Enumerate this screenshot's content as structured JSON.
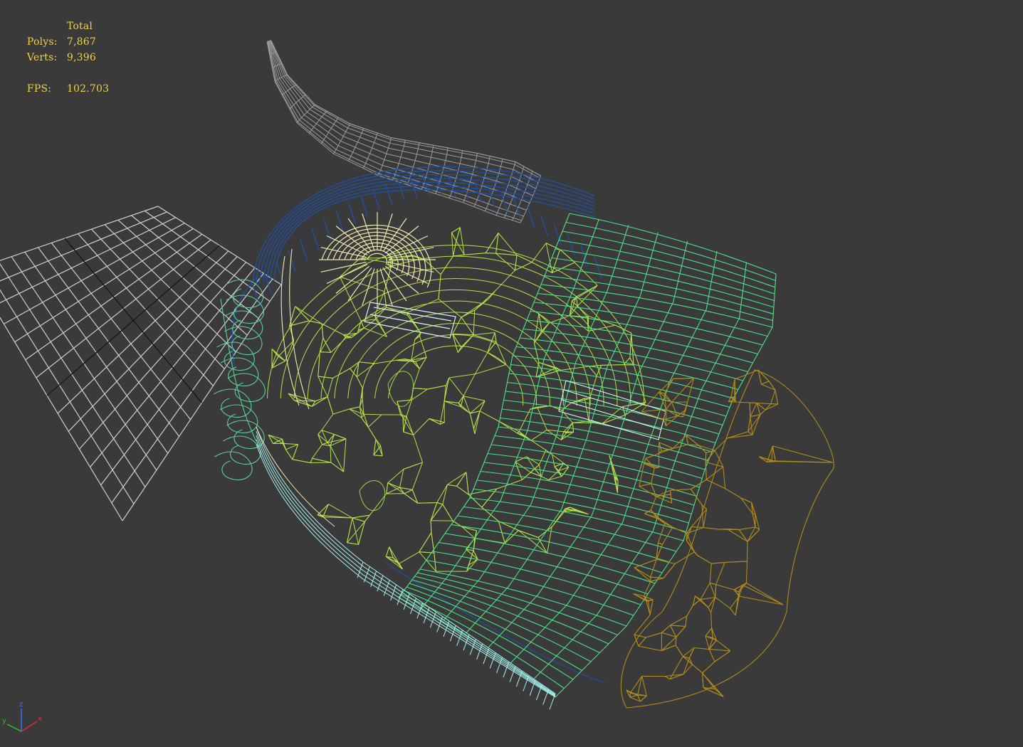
{
  "stats": {
    "header": "Total",
    "polys_label": "Polys:",
    "polys_value": "7,867",
    "verts_label": "Verts:",
    "verts_value": "9,396",
    "fps_label": "FPS:",
    "fps_value": "102.703"
  },
  "axis": {
    "x_label": "x",
    "y_label": "y",
    "z_label": "z"
  },
  "colors": {
    "background": "#3a3a3a",
    "stats_text": "#f2d04a",
    "grid": "#cfcfcf",
    "grid_axis": "#111111",
    "wire_blue": "#1f4fa0",
    "wire_green": "#4ee08a",
    "wire_yellow_green": "#b5e04a",
    "wire_cream": "#f0ecb0",
    "wire_orange": "#b08a1a",
    "wire_grey": "#9a9a9a",
    "wire_cyan": "#a8f0f0"
  }
}
